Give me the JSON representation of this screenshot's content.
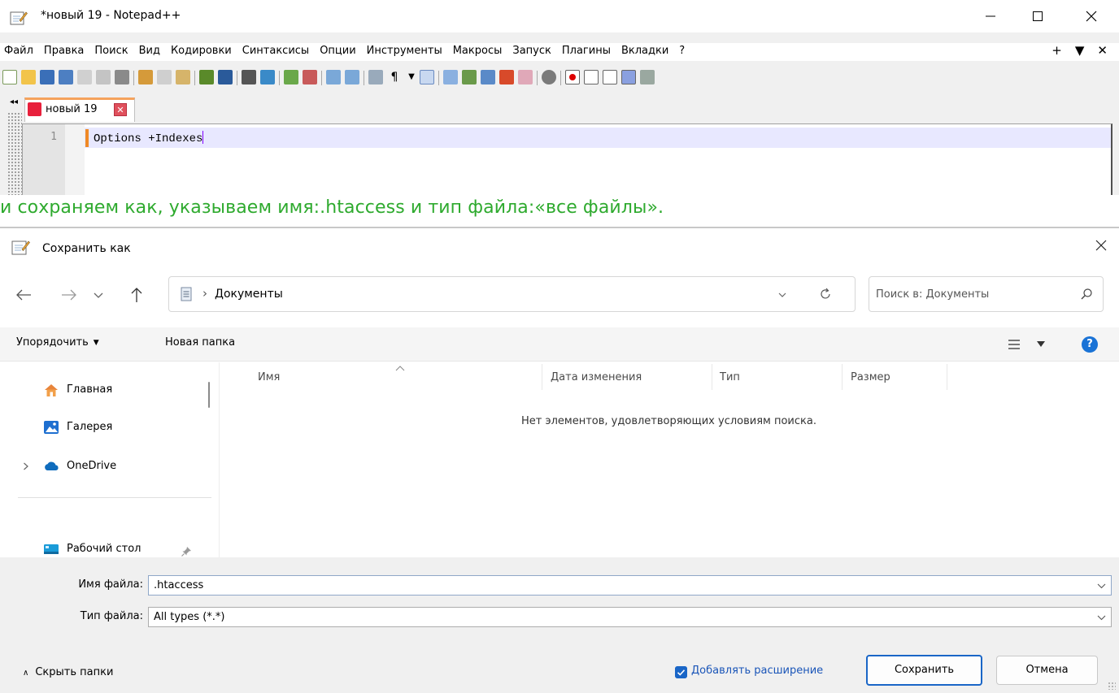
{
  "npp": {
    "title": "*новый 19 - Notepad++",
    "menu": [
      "Файл",
      "Правка",
      "Поиск",
      "Вид",
      "Кодировки",
      "Синтаксисы",
      "Опции",
      "Инструменты",
      "Макросы",
      "Запуск",
      "Плагины",
      "Вкладки",
      "?"
    ],
    "menu_right": [
      "+",
      "▼",
      "✕"
    ],
    "tab_label": "новый 19",
    "tab_close": "✕",
    "tab_scroll": "◂◂",
    "line_number": "1",
    "line_text": "Options +Indexes",
    "colors": {
      "change_marker": "#f08a24",
      "caret": "#8000ff",
      "tab_accent": "#f5a25c"
    }
  },
  "caption": "и сохраняем как, указываем имя:.htaccess и тип файла:«все файлы».",
  "dialog": {
    "title": "Сохранить как",
    "address_path": "Документы",
    "address_sep": "›",
    "search_placeholder": "Поиск в: Документы",
    "organize_label": "Упорядочить",
    "organize_caret": "▼",
    "new_folder_label": "Новая папка",
    "help_label": "?",
    "nav_items": [
      "Главная",
      "Галерея",
      "OneDrive",
      "Рабочий стол"
    ],
    "columns": [
      "Имя",
      "Дата изменения",
      "Тип",
      "Размер"
    ],
    "empty_message": "Нет элементов, удовлетворяющих условиям поиска.",
    "filename_label": "Имя файла:",
    "filename_value": ".htaccess",
    "filetype_label": "Тип файла:",
    "filetype_value": "All types (*.*)",
    "hide_folders_label": "Скрыть папки",
    "hide_folders_caret": "∧",
    "add_extension_label": "Добавлять расширение",
    "add_extension_checked": true,
    "save_button": "Сохранить",
    "cancel_button": "Отмена",
    "colors": {
      "accent": "#1a66c7",
      "caption_green": "#2eaa2e"
    }
  }
}
